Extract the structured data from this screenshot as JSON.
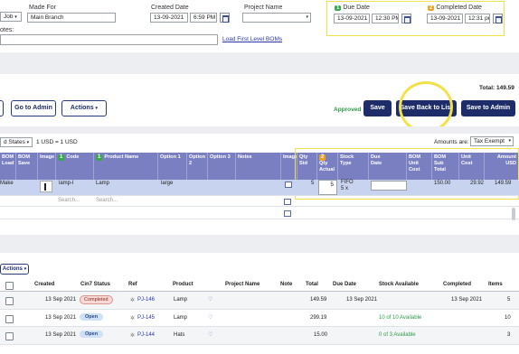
{
  "form": {
    "location_value": "Job",
    "made_for_label": "Made For",
    "made_for_value": "Main Branch",
    "created_date_label": "Created Date",
    "created_date": "13-09-2021",
    "created_time": "6:59 PM",
    "project_name_label": "Project Name",
    "project_name_value": "",
    "notes_label": "otes:",
    "due_date_label": "Due Date",
    "due_date": "13-09-2021",
    "due_time": "12:30 PM",
    "completed_date_label": "Completed Date",
    "completed_date": "13-09-2021",
    "completed_time": "12:31 pm",
    "load_bom_link": "Load First Level BOMs",
    "badge_1": "1",
    "badge_2": "2"
  },
  "toolbar": {
    "total_label": "Total: 149.59",
    "go_to_admin": "Go to Admin",
    "actions": "Actions",
    "status": "Approved",
    "save": "Save",
    "save_back": "Save Back to List",
    "save_admin": "Save to Admin"
  },
  "currency": {
    "select_value": "d States",
    "rate_text": "1 USD = 1 USD",
    "amounts_label": "Amounts are:",
    "tax_value": "Tax Exempt"
  },
  "bom_table": {
    "headers": [
      "BOM\nLoad",
      "BOM\nSave",
      "Image",
      "Code",
      "Product Name",
      "Option 1",
      "Option\n2",
      "Option 3",
      "Notes",
      "Image",
      "Qty\nStd",
      "Qty\nActual",
      "Stock\nType",
      "Due\nDate",
      "BOM Unit\nCost",
      "BOM\nSub Total",
      "Unit\nCost",
      "Amount\nUSD"
    ],
    "code_badge": "1",
    "product_badge": "1",
    "qty_badge": "2",
    "row": {
      "bom_load": "Make",
      "code": "lamp-l",
      "product": "Lamp",
      "option1": "large",
      "qty_std": "5",
      "qty_actual": "5",
      "stock_type": "FIFO\n5 x",
      "bom_unit_cost": "150.00",
      "unit_cost": "29.92",
      "amount": "149.59"
    },
    "search_placeholder_1": "Search...",
    "search_placeholder_2": "Search..."
  },
  "list": {
    "actions": "Actions",
    "headers": [
      "Created",
      "Cin7 Status",
      "Ref",
      "Product",
      "Project Name",
      "Note",
      "Total",
      "Due Date",
      "Stock Available",
      "Completed",
      "Items"
    ],
    "rows": [
      {
        "created": "13 Sep 2021",
        "status": "Completed",
        "ref": "PJ-146",
        "product": "Lamp",
        "total": "149.59",
        "due": "13 Sep 2021",
        "stock": "",
        "completed": "13 Sep 2021",
        "items": "5"
      },
      {
        "created": "13 Sep 2021",
        "status": "Open",
        "ref": "PJ-145",
        "product": "Lamp",
        "total": "299.19",
        "due": "",
        "stock": "10 of 10 Available",
        "completed": "",
        "items": "10"
      },
      {
        "created": "13 Sep 2021",
        "status": "Open",
        "ref": "PJ-144",
        "product": "Hats",
        "total": "15.00",
        "due": "",
        "stock": "0 of 3 Available",
        "completed": "",
        "items": "3"
      }
    ]
  },
  "colors": {
    "navy": "#1e2d6a",
    "header_purple": "#7a7fc2",
    "highlight_yellow": "#f2e24a",
    "row_selected": "#c8d3ef",
    "approved_green": "#2e9a4a"
  }
}
